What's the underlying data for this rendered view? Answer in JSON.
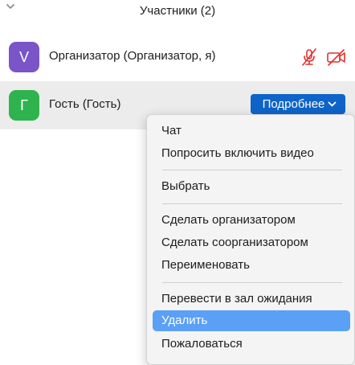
{
  "header": {
    "title": "Участники (2)",
    "collapse_icon": "chevron-down-icon"
  },
  "participants": [
    {
      "initial": "V",
      "name": "Организатор (Организатор, я)",
      "avatar_color": "#7a55c8",
      "mic_icon": "mic-muted-icon",
      "video_icon": "video-off-icon",
      "status_color": "#e0322f"
    },
    {
      "initial": "Г",
      "name": "Гость (Гость)",
      "avatar_color": "#2fb34f",
      "more_button_label": "Подробнее",
      "more_button_icon": "chevron-down-icon",
      "more_button_color": "#0e64c8"
    }
  ],
  "context_menu": {
    "items": [
      "Чат",
      "Попросить включить видео",
      "Выбрать",
      "Сделать организатором",
      "Сделать соорганизатором",
      "Переименовать",
      "Перевести в зал ожидания",
      "Удалить",
      "Пожаловаться"
    ],
    "highlighted": "Удалить",
    "highlight_color": "#5aa0f7"
  }
}
